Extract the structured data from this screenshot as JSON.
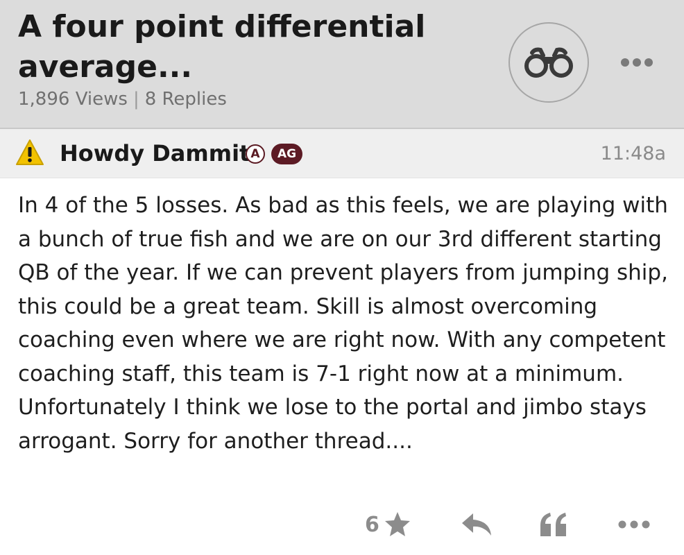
{
  "thread": {
    "title": "A four point differential\naverage...",
    "views": "1,896 Views",
    "separator": "|",
    "replies": "8 Replies"
  },
  "post": {
    "author": "Howdy Dammit",
    "badge_a": "A",
    "badge_ag": "AG",
    "time": "11:48a",
    "body": "In 4 of the 5 losses. As bad as this feels, we are playing with a bunch of true fish and we are on our 3rd different starting QB of the year. If we can prevent players from jumping ship, this could be a great team. Skill is almost overcoming coaching even where we are right now. With any competent coaching staff, this team is 7-1 right now at a minimum. Unfortunately I think we lose to the portal and jimbo stays arrogant. Sorry for another thread....",
    "star_count": "6"
  },
  "icons": {
    "watch": "binoculars-icon",
    "more": "more-dots-icon",
    "warning": "warning-icon",
    "star": "star-icon",
    "reply": "reply-icon",
    "quote": "quote-icon"
  },
  "colors": {
    "header_bg": "#dcdcdc",
    "badge_maroon": "#5c1a24",
    "warning_yellow": "#f2c200",
    "icon_gray": "#8c8c8c"
  }
}
